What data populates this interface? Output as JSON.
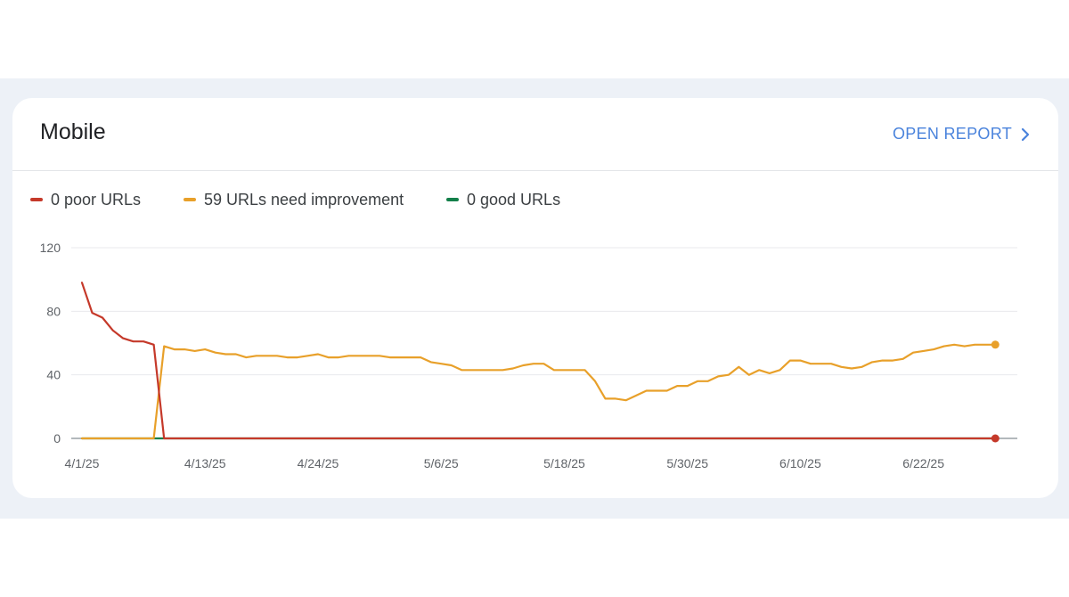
{
  "card": {
    "title": "Mobile",
    "open_report_label": "OPEN REPORT"
  },
  "legend": [
    {
      "label": "0 poor URLs",
      "color": "#c5392a"
    },
    {
      "label": "59 URLs need improvement",
      "color": "#e8a02a"
    },
    {
      "label": "0 good URLs",
      "color": "#137f4a"
    }
  ],
  "chart_data": {
    "type": "line",
    "x_tick_labels": [
      "4/1/25",
      "4/13/25",
      "4/24/25",
      "5/6/25",
      "5/18/25",
      "5/30/25",
      "6/10/25",
      "6/22/25"
    ],
    "x_tick_day_index": [
      0,
      12,
      23,
      35,
      47,
      59,
      70,
      82
    ],
    "y_ticks": [
      0,
      40,
      80,
      120
    ],
    "ylim": [
      0,
      120
    ],
    "grid": true,
    "legend_position": "top-left",
    "series": [
      {
        "name": "0 poor URLs",
        "color": "#c5392a",
        "values": [
          98,
          79,
          76,
          68,
          63,
          61,
          61,
          59,
          0,
          0,
          0,
          0,
          0,
          0,
          0,
          0,
          0,
          0,
          0,
          0,
          0,
          0,
          0,
          0,
          0,
          0,
          0,
          0,
          0,
          0,
          0,
          0,
          0,
          0,
          0,
          0,
          0,
          0,
          0,
          0,
          0,
          0,
          0,
          0,
          0,
          0,
          0,
          0,
          0,
          0,
          0,
          0,
          0,
          0,
          0,
          0,
          0,
          0,
          0,
          0,
          0,
          0,
          0,
          0,
          0,
          0,
          0,
          0,
          0,
          0,
          0,
          0,
          0,
          0,
          0,
          0,
          0,
          0,
          0,
          0,
          0,
          0,
          0,
          0,
          0,
          0,
          0,
          0,
          0,
          0
        ]
      },
      {
        "name": "59 URLs need improvement",
        "color": "#e8a02a",
        "values": [
          0,
          0,
          0,
          0,
          0,
          0,
          0,
          0,
          58,
          56,
          56,
          55,
          56,
          54,
          53,
          53,
          51,
          52,
          52,
          52,
          51,
          51,
          52,
          53,
          51,
          51,
          52,
          52,
          52,
          52,
          51,
          51,
          51,
          51,
          48,
          47,
          46,
          43,
          43,
          43,
          43,
          43,
          44,
          46,
          47,
          47,
          43,
          43,
          43,
          43,
          36,
          25,
          25,
          24,
          27,
          30,
          30,
          30,
          33,
          33,
          36,
          36,
          39,
          40,
          45,
          40,
          43,
          41,
          43,
          49,
          49,
          47,
          47,
          47,
          45,
          44,
          45,
          48,
          49,
          49,
          50,
          54,
          55,
          56,
          58,
          59,
          58,
          59,
          59,
          59
        ]
      },
      {
        "name": "0 good URLs",
        "color": "#137f4a",
        "values": [
          0,
          0,
          0,
          0,
          0,
          0,
          0,
          0,
          0,
          0,
          0,
          0,
          0,
          0,
          0,
          0,
          0,
          0,
          0,
          0,
          0,
          0,
          0,
          0,
          0,
          0,
          0,
          0,
          0,
          0,
          0,
          0,
          0,
          0,
          0,
          0,
          0,
          0,
          0,
          0,
          0,
          0,
          0,
          0,
          0,
          0,
          0,
          0,
          0,
          0,
          0,
          0,
          0,
          0,
          0,
          0,
          0,
          0,
          0,
          0,
          0,
          0,
          0,
          0,
          0,
          0,
          0,
          0,
          0,
          0,
          0,
          0,
          0,
          0,
          0,
          0,
          0,
          0,
          0,
          0,
          0,
          0,
          0,
          0,
          0,
          0,
          0,
          0,
          0,
          0
        ]
      }
    ]
  }
}
